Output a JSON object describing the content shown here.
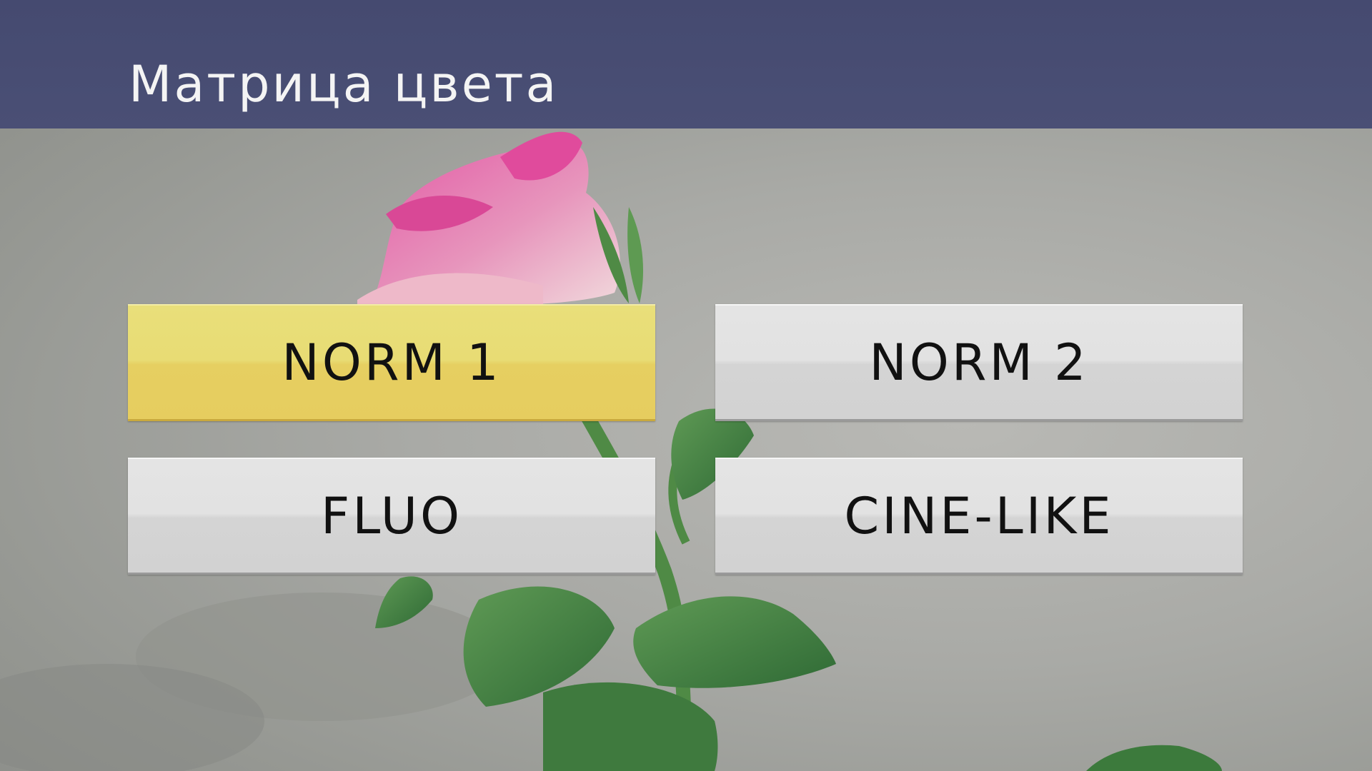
{
  "menu": {
    "title": "Матрица цвета",
    "options": [
      {
        "label": "NORM 1",
        "selected": true
      },
      {
        "label": "NORM 2",
        "selected": false
      },
      {
        "label": "FLUO",
        "selected": false
      },
      {
        "label": "CINE-LIKE",
        "selected": false
      }
    ]
  },
  "colors": {
    "header_bg": "#474c72",
    "selected_bg": "#e8d86f",
    "option_bg": "#dedede",
    "text": "#111111",
    "title_text": "#f4f4f4"
  },
  "background": {
    "subject": "pink-rose-photo"
  }
}
